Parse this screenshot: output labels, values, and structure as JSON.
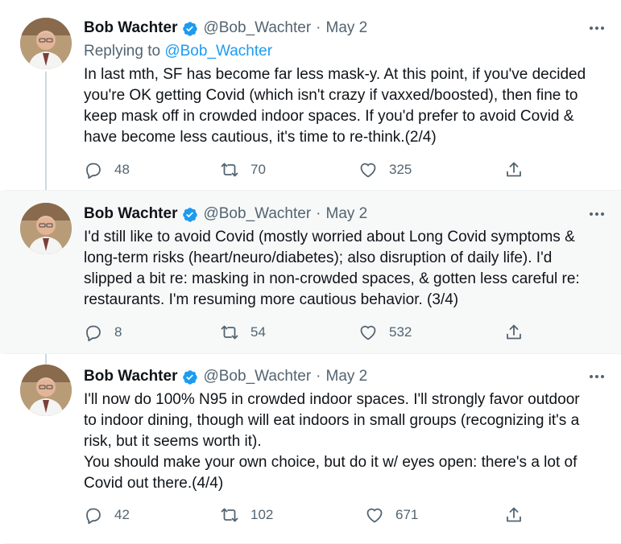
{
  "tweets": [
    {
      "author_name": "Bob Wachter",
      "handle": "@Bob_Wachter",
      "date": "May 2",
      "replying_to_prefix": "Replying to ",
      "replying_to_handle": "@Bob_Wachter",
      "text": "In last mth, SF has become far less mask-y. At this point, if you've decided\nyou're OK getting Covid (which isn't crazy if vaxxed/boosted), then fine to\nkeep mask off in crowded indoor spaces. If you'd prefer to avoid Covid &\nhave become less cautious, it's time to re-think.(2/4)",
      "replies": "48",
      "retweets": "70",
      "likes": "325"
    },
    {
      "author_name": "Bob Wachter",
      "handle": "@Bob_Wachter",
      "date": "May 2",
      "text": "I'd still like to avoid Covid (mostly worried about Long Covid symptoms &\nlong-term risks (heart/neuro/diabetes); also disruption of daily life). I'd\nslipped a bit re: masking in non-crowded spaces, & gotten less careful re:\nrestaurants. I'm resuming more cautious behavior. (3/4)",
      "replies": "8",
      "retweets": "54",
      "likes": "532"
    },
    {
      "author_name": "Bob Wachter",
      "handle": "@Bob_Wachter",
      "date": "May 2",
      "text": "I'll now do 100% N95 in crowded indoor spaces. I'll strongly favor outdoor\nto indoor dining, though will eat indoors in small groups (recognizing it's a\nrisk, but it seems worth it).\nYou should make your own choice, but do it w/ eyes open: there's a lot of\nCovid out there.(4/4)",
      "replies": "42",
      "retweets": "102",
      "likes": "671"
    }
  ],
  "separator": "·",
  "more_glyph": "•••",
  "icons": {
    "verified": "verified-badge-icon",
    "reply": "reply-icon",
    "retweet": "retweet-icon",
    "like": "heart-icon",
    "share": "share-icon",
    "more": "more-icon"
  },
  "colors": {
    "link": "#1d9bf0",
    "secondary_text": "#536471",
    "primary_text": "#0f1419",
    "highlight_bg": "#f7f9f9",
    "thread_line": "#cfd9de"
  }
}
